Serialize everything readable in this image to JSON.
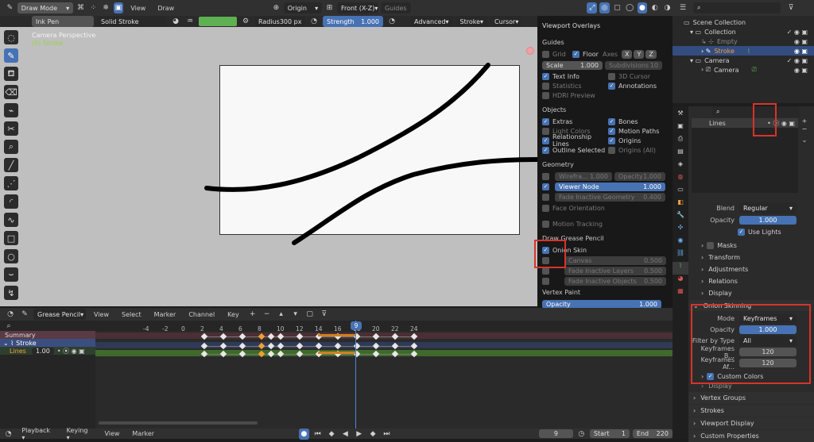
{
  "header": {
    "mode": "Draw Mode",
    "menu": [
      "View",
      "Draw"
    ],
    "origin": "Origin",
    "view_axis": "Front (X-Z)",
    "guides": "Guides"
  },
  "toolbar2": {
    "brush": "Ink Pen",
    "stroke_type": "Solid Stroke",
    "radius_label": "Radius",
    "radius_value": "300 px",
    "strength_label": "Strength",
    "strength_value": "1.000",
    "advanced": "Advanced",
    "stroke": "Stroke",
    "cursor": "Cursor"
  },
  "viewport": {
    "perspective": "Camera Perspective",
    "object": "(9) Stroke"
  },
  "overlays": {
    "title": "Viewport Overlays",
    "guides_label": "Guides",
    "grid": "Grid",
    "floor": "Floor",
    "axes": "Axes",
    "x": "X",
    "y": "Y",
    "z": "Z",
    "scale_label": "Scale",
    "scale_value": "1.000",
    "subdiv_label": "Subdivisions",
    "subdiv_value": "10",
    "text_info": "Text Info",
    "cursor_3d": "3D Cursor",
    "statistics": "Statistics",
    "annotations": "Annotations",
    "hdri": "HDRI Preview",
    "objects_label": "Objects",
    "extras": "Extras",
    "bones": "Bones",
    "light_colors": "Light Colors",
    "motion_paths": "Motion Paths",
    "relationship_lines": "Relationship Lines",
    "origins": "Origins",
    "outline_selected": "Outline Selected",
    "origins_all": "Origins (All)",
    "geometry_label": "Geometry",
    "wireframe_label": "Wirefra...",
    "wireframe_value": "1.000",
    "opacity_label": "Opacity",
    "opacity_value": "1.000",
    "viewer_node": "Viewer Node",
    "viewer_value": "1.000",
    "fade_geo": "Fade Inactive Geometry",
    "fade_geo_value": "0.400",
    "face_orientation": "Face Orientation",
    "motion_tracking": "Motion Tracking",
    "gp_label": "Draw Grease Pencil",
    "onion_skin": "Onion Skin",
    "canvas_label": "Canvas",
    "canvas_value": "0.500",
    "fade_layers": "Fade Inactive Layers",
    "fade_layers_value": "0.500",
    "fade_objects": "Fade Inactive Objects",
    "fade_objects_value": "0.500",
    "vertex_paint_label": "Vertex Paint",
    "vp_opacity_label": "Opacity",
    "vp_opacity_value": "1.000"
  },
  "outliner": {
    "scene_collection": "Scene Collection",
    "collection": "Collection",
    "empty": "Empty",
    "stroke": "Stroke",
    "camera_coll": "Camera",
    "camera_obj": "Camera"
  },
  "properties": {
    "layer_name": "Lines",
    "blend_label": "Blend",
    "blend_value": "Regular",
    "opacity_label": "Opacity",
    "opacity_value": "1.000",
    "use_lights": "Use Lights",
    "masks": "Masks",
    "transform": "Transform",
    "adjustments": "Adjustments",
    "relations": "Relations",
    "display": "Display",
    "onion_skinning": "Onion Skinning",
    "mode_label": "Mode",
    "mode_value": "Keyframes",
    "os_opacity_label": "Opacity",
    "os_opacity_value": "1.000",
    "filter_label": "Filter by Type",
    "filter_value": "All",
    "kf_before_label": "Keyframes B...",
    "kf_before_value": "120",
    "kf_after_label": "Keyframes Af...",
    "kf_after_value": "120",
    "custom_colors": "Custom Colors",
    "display2": "Display",
    "vertex_groups": "Vertex Groups",
    "strokes": "Strokes",
    "viewport_display": "Viewport Display",
    "custom_properties": "Custom Properties"
  },
  "timeline": {
    "editor": "Grease Pencil",
    "menu": [
      "View",
      "Select",
      "Marker",
      "Channel",
      "Key"
    ],
    "frames": [
      "-4",
      "-2",
      "0",
      "2",
      "4",
      "6",
      "8",
      "9",
      "10",
      "12",
      "14",
      "16",
      "18",
      "20",
      "22",
      "24"
    ],
    "summary": "Summary",
    "stroke": "Stroke",
    "lines": "Lines",
    "lines_value": "1.00",
    "current_frame": 9
  },
  "status": {
    "playback": "Playback",
    "keying": "Keying",
    "view": "View",
    "marker": "Marker",
    "frame": "9",
    "start_label": "Start",
    "start_value": "1",
    "end_label": "End",
    "end_value": "220"
  }
}
